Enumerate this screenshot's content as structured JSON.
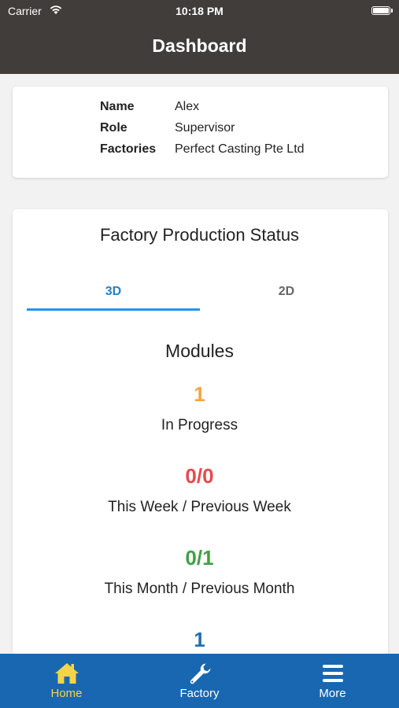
{
  "status_bar": {
    "carrier": "Carrier",
    "time": "10:18 PM"
  },
  "header": {
    "title": "Dashboard"
  },
  "user": {
    "rows": [
      {
        "label": "Name",
        "value": "Alex"
      },
      {
        "label": "Role",
        "value": "Supervisor"
      },
      {
        "label": "Factories",
        "value": "Perfect Casting Pte Ltd"
      }
    ]
  },
  "production": {
    "title": "Factory Production Status",
    "tabs": [
      {
        "label": "3D",
        "active": true
      },
      {
        "label": "2D",
        "active": false
      }
    ],
    "section_title": "Modules",
    "stats": [
      {
        "value": "1",
        "label": "In Progress",
        "color": "#f5a442"
      },
      {
        "value": "0/0",
        "label": "This Week / Previous Week",
        "color": "#e84a4f"
      },
      {
        "value": "0/1",
        "label": "This Month / Previous Month",
        "color": "#3fa145"
      },
      {
        "value": "1",
        "label": "",
        "color": "#1f6fae"
      }
    ]
  },
  "tabbar": {
    "items": [
      {
        "label": "Home",
        "icon": "home-icon",
        "active": true
      },
      {
        "label": "Factory",
        "icon": "wrench-icon",
        "active": false
      },
      {
        "label": "More",
        "icon": "menu-icon",
        "active": false
      }
    ],
    "active_color": "#f5d547",
    "inactive_color": "#ffffff",
    "background": "#1a67b1"
  },
  "colors": {
    "header": "#413d3a",
    "tab_accent": "#2196f3"
  }
}
